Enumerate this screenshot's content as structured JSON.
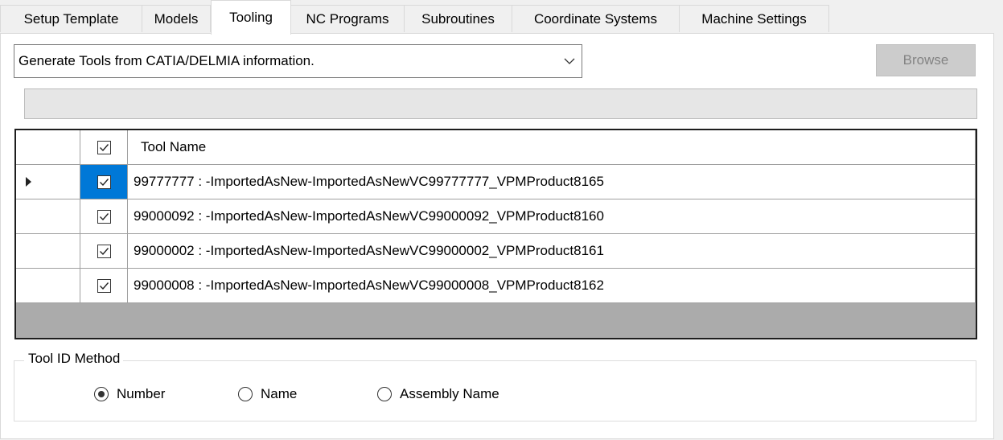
{
  "tabs": [
    {
      "label": "Setup Template",
      "active": false
    },
    {
      "label": "Models",
      "active": false
    },
    {
      "label": "Tooling",
      "active": true
    },
    {
      "label": "NC Programs",
      "active": false
    },
    {
      "label": "Subroutines",
      "active": false
    },
    {
      "label": "Coordinate Systems",
      "active": false
    },
    {
      "label": "Machine Settings",
      "active": false
    }
  ],
  "source_combo": {
    "value": "Generate Tools from CATIA/DELMIA information.",
    "icon": "chevron-down-icon"
  },
  "browse_button": {
    "label": "Browse",
    "enabled": false
  },
  "progress": {
    "value": 0
  },
  "grid": {
    "header": {
      "tool_name": "Tool Name",
      "checked": true
    },
    "rows": [
      {
        "tool": "99777777 : -ImportedAsNew-ImportedAsNewVC99777777_VPMProduct8165",
        "checked": true,
        "current": true
      },
      {
        "tool": "99000092 : -ImportedAsNew-ImportedAsNewVC99000092_VPMProduct8160",
        "checked": true,
        "current": false
      },
      {
        "tool": "99000002 : -ImportedAsNew-ImportedAsNewVC99000002_VPMProduct8161",
        "checked": true,
        "current": false
      },
      {
        "tool": "99000008 : -ImportedAsNew-ImportedAsNewVC99000008_VPMProduct8162",
        "checked": true,
        "current": false
      }
    ]
  },
  "tool_id_method": {
    "title": "Tool ID Method",
    "options": [
      {
        "label": "Number",
        "selected": true
      },
      {
        "label": "Name",
        "selected": false
      },
      {
        "label": "Assembly Name",
        "selected": false
      }
    ]
  },
  "colors": {
    "selection": "#0078d7",
    "grid_empty": "#ababab"
  }
}
